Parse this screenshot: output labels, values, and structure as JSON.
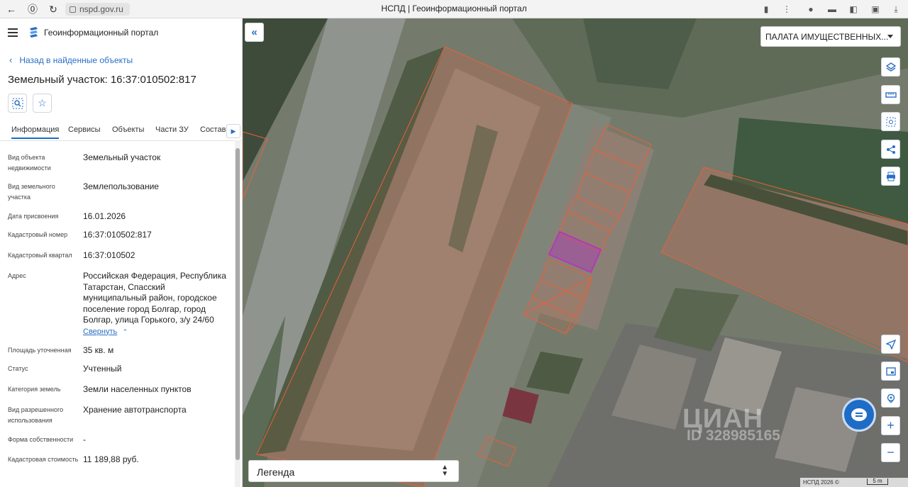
{
  "browser": {
    "url": "nspd.gov.ru",
    "page_title": "НСПД | Геоинформационный портал"
  },
  "sidebar": {
    "portal_title": "Геоинформационный портал",
    "back_link": "Назад в найденные объекты",
    "object_title": "Земельный участок: 16:37:010502:817",
    "tabs": [
      "Информация",
      "Сервисы",
      "Объекты",
      "Части ЗУ",
      "Состав"
    ],
    "active_tab": "Информация",
    "info": [
      {
        "label": "Вид объекта недвижимости",
        "value": "Земельный участок"
      },
      {
        "label": "Вид земельного участка",
        "value": "Землепользование"
      },
      {
        "label": "Дата присвоения",
        "value": "16.01.2026"
      },
      {
        "label": "Кадастровый номер",
        "value": "16:37:010502:817"
      },
      {
        "label": "Кадастровый квартал",
        "value": "16:37:010502"
      },
      {
        "label": "Адрес",
        "value": "Российская Федерация, Республика Татарстан, Спасский муниципальный район, городское поселение город Болгар, город Болгар, улица Горького, з/у 24/60"
      },
      {
        "label": "Площадь уточненная",
        "value": "35 кв. м"
      },
      {
        "label": "Статус",
        "value": "Учтенный"
      },
      {
        "label": "Категория земель",
        "value": "Земли населенных пунктов"
      },
      {
        "label": "Вид разрешенного использования",
        "value": "Хранение автотранспорта"
      },
      {
        "label": "Форма собственности",
        "value": "-"
      },
      {
        "label": "Кадастровая стоимость",
        "value": "11 189,88 руб."
      }
    ],
    "collapse_label": "Свернуть"
  },
  "map": {
    "layer_select": "ПАЛАТА ИМУЩЕСТВЕННЫХ...",
    "legend_label": "Легенда",
    "watermark": "ЦИАН",
    "watermark_id": "ID 328985165",
    "copyright": "НСПД 2026 ©",
    "scale": "5 m",
    "accent_color": "#1e6cc6",
    "parcel_outline_color": "#e8603c",
    "selected_parcel_color": "#b03ab8",
    "right_buttons": [
      "layers-icon",
      "ruler-icon",
      "select-area-icon",
      "share-icon",
      "print-icon"
    ],
    "bottom_buttons": [
      "locate-icon",
      "minimap-icon",
      "pin-search-icon",
      "zoom-in-icon",
      "zoom-out-icon"
    ]
  }
}
